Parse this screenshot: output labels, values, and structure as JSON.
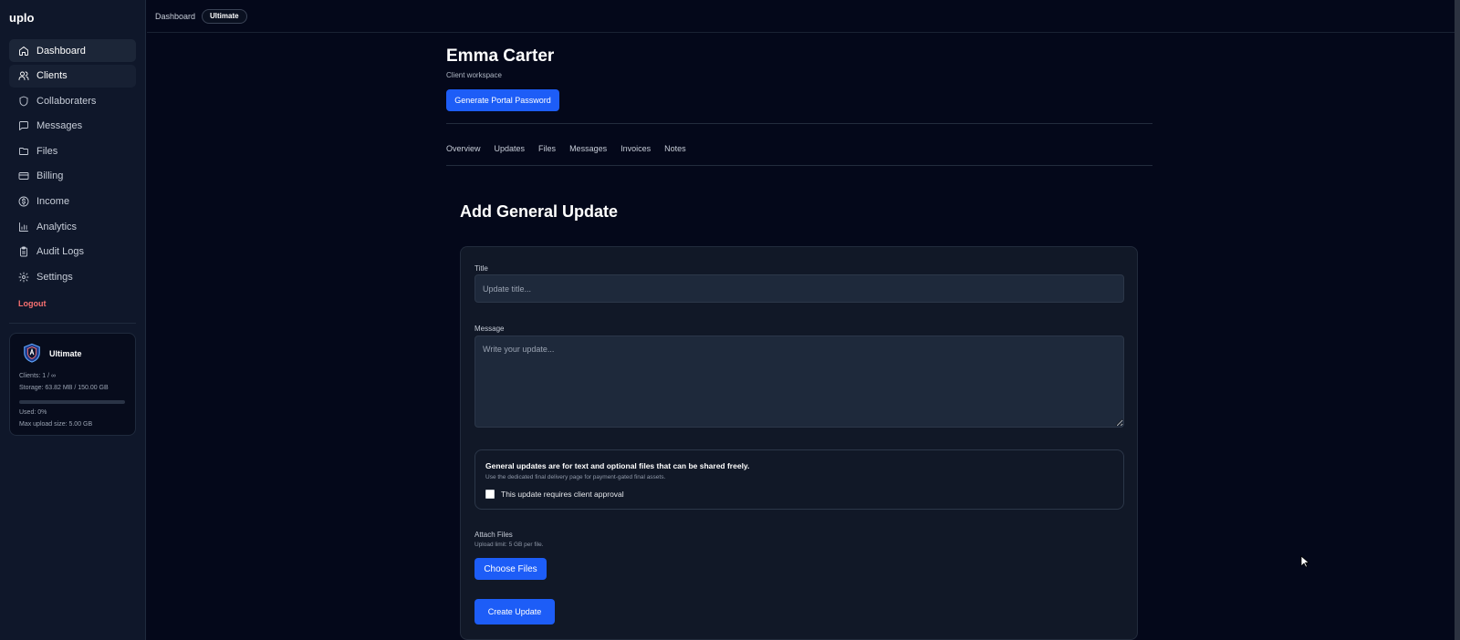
{
  "app": {
    "brand": "uplo"
  },
  "sidebar": {
    "items": [
      {
        "label": "Dashboard",
        "icon": "home-icon"
      },
      {
        "label": "Clients",
        "icon": "users-icon"
      },
      {
        "label": "Collaboraters",
        "icon": "shield-icon"
      },
      {
        "label": "Messages",
        "icon": "message-icon"
      },
      {
        "label": "Files",
        "icon": "folder-icon"
      },
      {
        "label": "Billing",
        "icon": "credit-card-icon"
      },
      {
        "label": "Income",
        "icon": "dollar-icon"
      },
      {
        "label": "Analytics",
        "icon": "bar-chart-icon"
      },
      {
        "label": "Audit Logs",
        "icon": "clipboard-icon"
      },
      {
        "label": "Settings",
        "icon": "gear-icon"
      }
    ],
    "logout_label": "Logout",
    "plan": {
      "name": "Ultimate",
      "icon": "shield-badge-icon",
      "clients": "Clients: 1 / ∞",
      "storage": "Storage: 63.82 MB / 150.00 GB",
      "used": "Used: 0%",
      "used_fraction": 0.0,
      "max_upload": "Max upload size: 5.00 GB"
    }
  },
  "topbar": {
    "breadcrumb": "Dashboard",
    "badge": "Ultimate"
  },
  "header": {
    "client_name": "Emma Carter",
    "subtitle": "Client workspace",
    "portal_button": "Generate Portal Password"
  },
  "tabs": [
    "Overview",
    "Updates",
    "Files",
    "Messages",
    "Invoices",
    "Notes"
  ],
  "form": {
    "heading": "Add General Update",
    "title_label": "Title",
    "title_placeholder": "Update title...",
    "title_value": "",
    "message_label": "Message",
    "message_placeholder": "Write your update...",
    "message_value": "",
    "notice_title": "General updates are for text and optional files that can be shared freely.",
    "notice_sub": "Use the dedicated final delivery page for payment-gated final assets.",
    "approval_label": "This update requires client approval",
    "approval_checked": false,
    "attach_label": "Attach Files",
    "upload_limit": "Upload limit: 5 GB per file.",
    "choose_button": "Choose Files",
    "create_button": "Create Update"
  },
  "colors": {
    "accent": "#1d5df7",
    "background": "#04081a",
    "sidebar": "#0f172a",
    "logout": "#f87171"
  }
}
